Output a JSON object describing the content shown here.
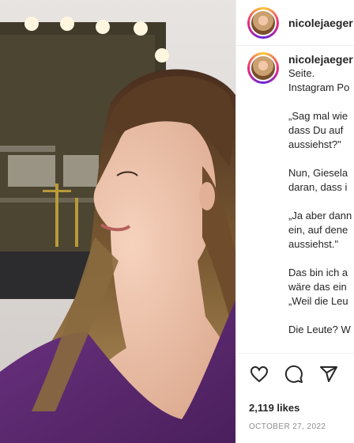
{
  "post": {
    "username": "nicolejaeger",
    "caption_lines": [
      "Seite.",
      "Instagram Po",
      "",
      "„Sag mal wie",
      "dass Du auf",
      "aussiehst?\"",
      "",
      "Nun, Giesela",
      "daran, dass i",
      "",
      "„Ja aber dann",
      "ein, auf dene",
      "aussiehst.\"",
      "",
      "Das bin ich a",
      "wäre das ein",
      "„Weil die Leu",
      "",
      "Die Leute? W"
    ],
    "likes": "2,119 likes",
    "date": "OCTOBER 27, 2022"
  },
  "icons": {
    "like": "heart-icon",
    "comment": "comment-icon",
    "share": "share-icon"
  },
  "colors": {
    "dress": "#5d2a6e",
    "text": "#262626",
    "muted": "#8e8e8e"
  }
}
